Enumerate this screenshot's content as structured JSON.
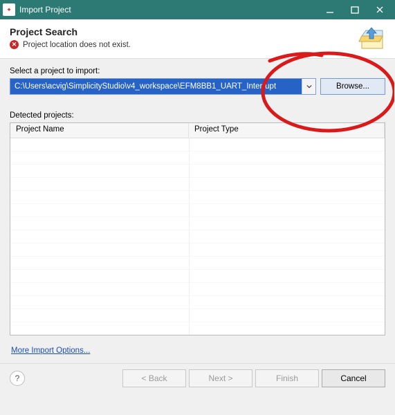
{
  "window": {
    "title": "Import Project"
  },
  "header": {
    "title": "Project Search",
    "error": "Project location does not exist."
  },
  "fields": {
    "select_label": "Select a project to import:",
    "path_value": "C:\\Users\\acvig\\SimplicityStudio\\v4_workspace\\EFM8BB1_UART_Interrupt",
    "browse_label": "Browse...",
    "detected_label": "Detected projects:"
  },
  "table": {
    "cols": {
      "name": "Project Name",
      "type": "Project Type"
    }
  },
  "links": {
    "more_options": "More Import Options..."
  },
  "footer": {
    "help": "?",
    "back": "< Back",
    "next": "Next >",
    "finish": "Finish",
    "cancel": "Cancel"
  }
}
